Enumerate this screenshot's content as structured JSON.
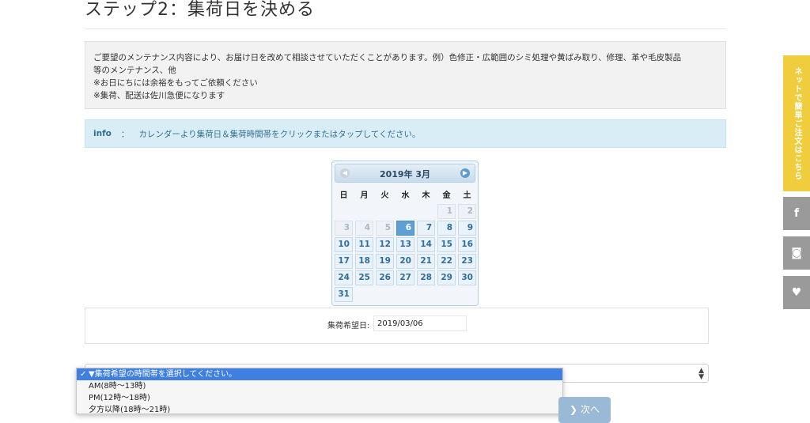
{
  "page": {
    "title": "ステップ2：集荷日を決める"
  },
  "notice": {
    "lines": [
      "ご要望のメンテナンス内容により、お届け日を改めて相談させていただくことがあります。例）色修正・広範囲のシミ処理や黄ばみ取り、修理、革や毛皮製品",
      "等のメンテナンス、他",
      "※お日にちには余裕をもってご依頼ください",
      "※集荷、配送は佐川急便になります"
    ]
  },
  "info": {
    "label": "info",
    "separator": "：",
    "text": "カレンダーより集荷日＆集荷時間帯をクリックまたはタップしてください。"
  },
  "calendar": {
    "month_label": "2019年 3月",
    "prev_icon": "circle-left",
    "next_icon": "circle-right",
    "weekdays": [
      "日",
      "月",
      "火",
      "水",
      "木",
      "金",
      "土"
    ],
    "weeks": [
      [
        "",
        "",
        "",
        "",
        "",
        "1",
        "2"
      ],
      [
        "3",
        "4",
        "5",
        "6",
        "7",
        "8",
        "9"
      ],
      [
        "10",
        "11",
        "12",
        "13",
        "14",
        "15",
        "16"
      ],
      [
        "17",
        "18",
        "19",
        "20",
        "21",
        "22",
        "23"
      ],
      [
        "24",
        "25",
        "26",
        "27",
        "28",
        "29",
        "30"
      ],
      [
        "31",
        "",
        "",
        "",
        "",
        "",
        ""
      ]
    ],
    "disabled_days": [
      "1",
      "2",
      "3",
      "4",
      "5"
    ],
    "selected_day": "6"
  },
  "date_field": {
    "label": "集荷希望日:",
    "value": "2019/03/06"
  },
  "time_select": {
    "options": [
      "▼集荷希望の時間帯を選択してください。",
      "AM(8時〜13時)",
      "PM(12時〜18時)",
      "夕方以降(18時〜21時)"
    ],
    "selected_index": 0,
    "check_mark": "✓"
  },
  "buttons": {
    "next_label": "次へ",
    "next_icon": "chevron-right"
  },
  "side": {
    "cta_label": "ネットで簡単ご注文はこちら",
    "facebook_glyph": "f",
    "instagram_glyph": "◙",
    "twitter_glyph": "♥"
  },
  "colors": {
    "side_cta": "#efcd3c",
    "side_social": "#9a9a9a",
    "info_bg": "#d9edf7",
    "selected_day": "#5e9fd6",
    "dropdown_selected": "#3f7fe0"
  }
}
